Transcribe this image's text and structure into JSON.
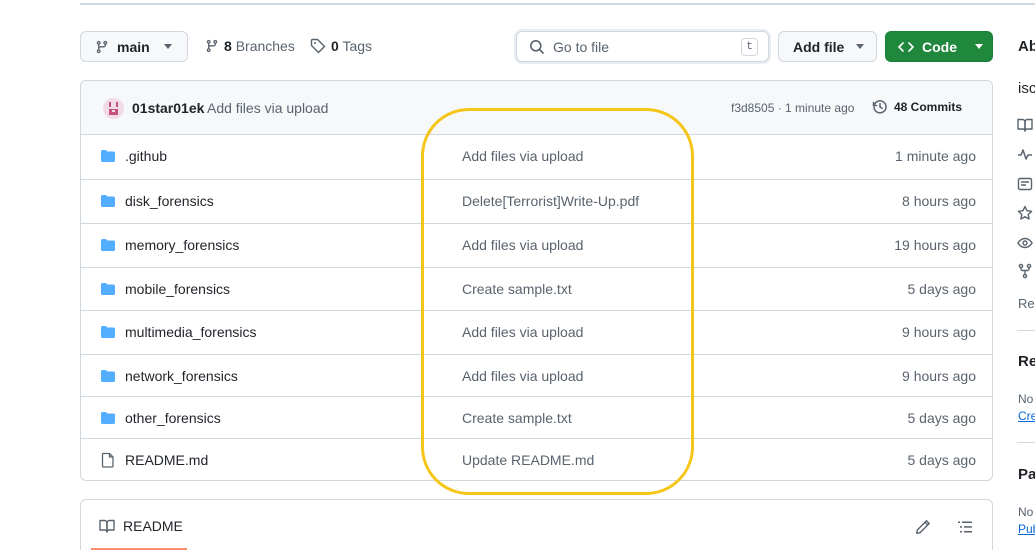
{
  "toolbar": {
    "branch": "main",
    "branches_count": "8",
    "branches_label": "Branches",
    "tags_count": "0",
    "tags_label": "Tags",
    "search_placeholder": "Go to file",
    "search_shortcut": "t",
    "add_file_label": "Add file",
    "code_label": "Code"
  },
  "commit": {
    "user": "01star01ek",
    "message": "Add files via upload",
    "hash_time": "f3d8505 · 1 minute ago",
    "commits_label": "48 Commits"
  },
  "files": [
    {
      "name": ".github",
      "type": "folder",
      "message": "Add files via upload",
      "age": "1 minute ago"
    },
    {
      "name": "disk_forensics",
      "type": "folder",
      "message": "Delete[Terrorist]Write-Up.pdf",
      "age": "8 hours ago"
    },
    {
      "name": "memory_forensics",
      "type": "folder",
      "message": "Add files via upload",
      "age": "19 hours ago"
    },
    {
      "name": "mobile_forensics",
      "type": "folder",
      "message": "Create sample.txt",
      "age": "5 days ago"
    },
    {
      "name": "multimedia_forensics",
      "type": "folder",
      "message": "Add files via upload",
      "age": "9 hours ago"
    },
    {
      "name": "network_forensics",
      "type": "folder",
      "message": "Add files via upload",
      "age": "9 hours ago"
    },
    {
      "name": "other_forensics",
      "type": "folder",
      "message": "Create sample.txt",
      "age": "5 days ago"
    },
    {
      "name": "README.md",
      "type": "file",
      "message": "Update README.md",
      "age": "5 days ago"
    }
  ],
  "readme": {
    "title": "README"
  },
  "sidebar": {
    "heading_partial": "Ab",
    "desc_partial": "isc",
    "re_partial": "Re",
    "releases_partial": "Re",
    "releases_none": "No",
    "releases_link": "Cre",
    "packages_partial": "Pa",
    "packages_none": "No",
    "packages_link": "Pub"
  },
  "colors": {
    "accent_green": "#1f883d",
    "folder_blue": "#54aeff",
    "highlight": "#f5c518"
  }
}
